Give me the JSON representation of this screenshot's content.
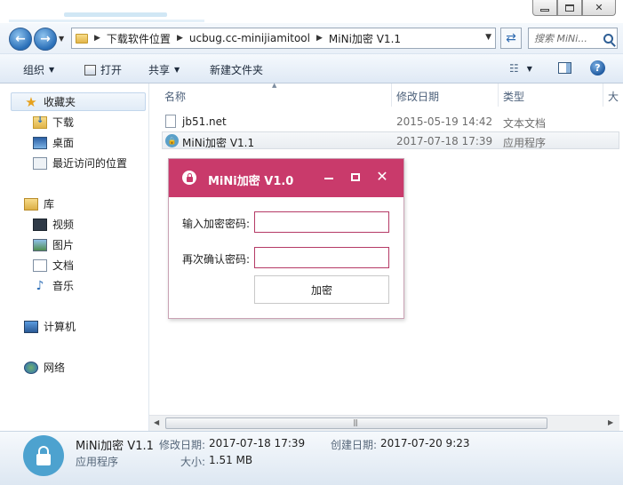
{
  "window": {
    "minimize_glyph": "",
    "close_glyph": "✕"
  },
  "address": {
    "crumbs": [
      "下载软件位置",
      "ucbug.cc-minijiamitool",
      "MiNi加密 V1.1"
    ]
  },
  "search": {
    "placeholder": "搜索 MiNi..."
  },
  "toolbar": {
    "organize": "组织",
    "open": "打开",
    "share": "共享",
    "new_folder": "新建文件夹"
  },
  "sidebar": {
    "favorites": "收藏夹",
    "favorites_items": [
      "下载",
      "桌面",
      "最近访问的位置"
    ],
    "libraries": "库",
    "library_items": [
      "视频",
      "图片",
      "文档",
      "音乐"
    ],
    "computer": "计算机",
    "network": "网络"
  },
  "columns": {
    "name": "名称",
    "date": "修改日期",
    "type": "类型",
    "size": "大"
  },
  "files": [
    {
      "name": "jb51.net",
      "date": "2015-05-19 14:42",
      "type": "文本文档"
    },
    {
      "name": "MiNi加密 V1.1",
      "date": "2017-07-18 17:39",
      "type": "应用程序"
    }
  ],
  "details": {
    "name": "MiNi加密 V1.1",
    "kind": "应用程序",
    "modified_label": "修改日期:",
    "modified_value": "2017-07-18 17:39",
    "created_label": "创建日期:",
    "created_value": "2017-07-20 9:23",
    "size_label": "大小:",
    "size_value": "1.51 MB"
  },
  "dialog": {
    "title": "MiNi加密 V1.0",
    "password_label": "输入加密密码:",
    "password_value": "",
    "confirm_label": "再次确认密码:",
    "confirm_value": "",
    "encrypt_button": "加密"
  },
  "colors": {
    "dialog_accent": "#c93a6b",
    "app_icon": "#4da2cf"
  }
}
